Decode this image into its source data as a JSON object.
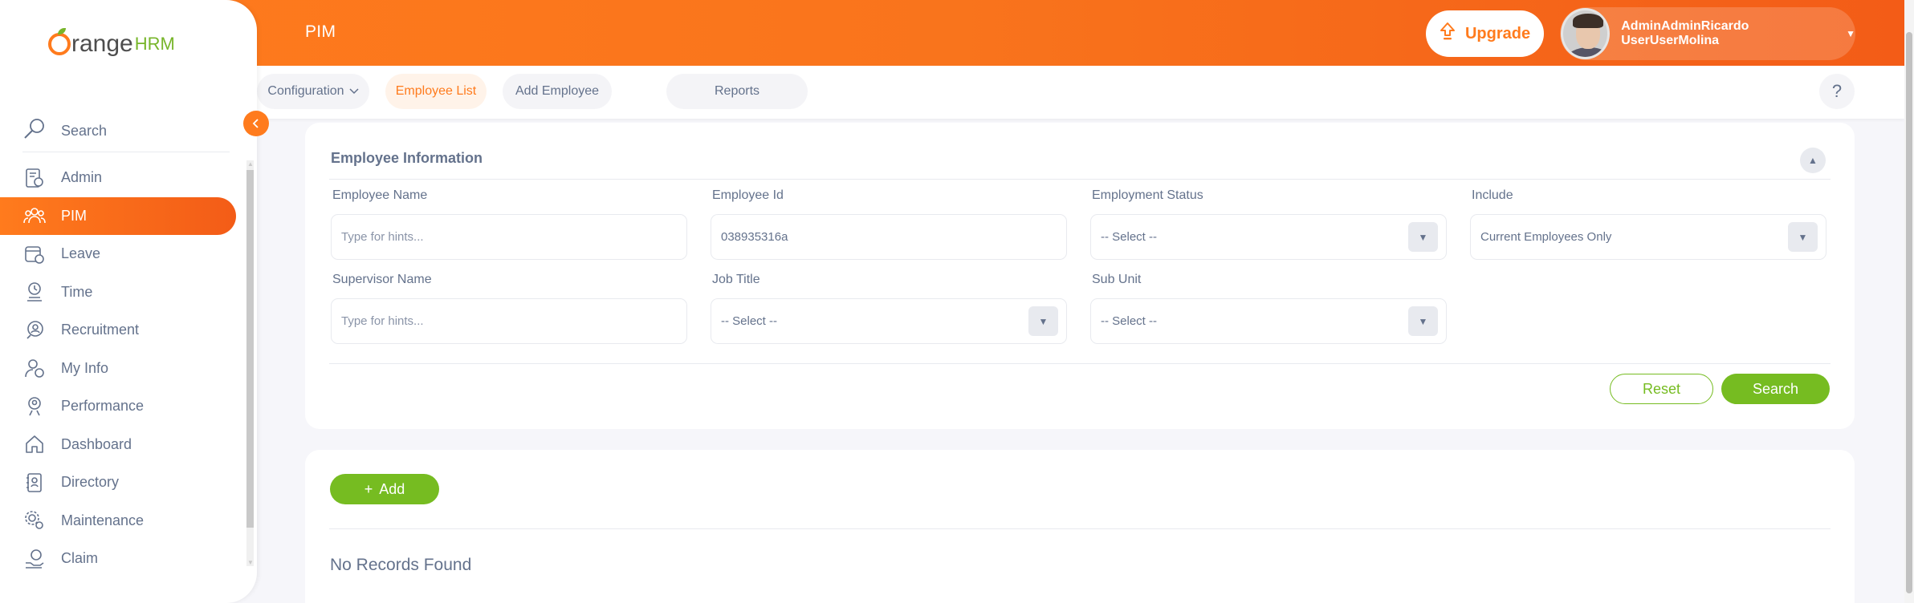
{
  "header": {
    "title": "PIM",
    "upgrade_label": "Upgrade",
    "user_name": "AdminAdminRicardo UserUserMolina"
  },
  "subnav": {
    "configuration": "Configuration",
    "employee_list": "Employee List",
    "add_employee": "Add Employee",
    "reports": "Reports",
    "help": "?"
  },
  "sidebar": {
    "logo_text": "range",
    "logo_suffix": "HRM",
    "search_label": "Search",
    "items": [
      {
        "label": "Admin"
      },
      {
        "label": "PIM"
      },
      {
        "label": "Leave"
      },
      {
        "label": "Time"
      },
      {
        "label": "Recruitment"
      },
      {
        "label": "My Info"
      },
      {
        "label": "Performance"
      },
      {
        "label": "Dashboard"
      },
      {
        "label": "Directory"
      },
      {
        "label": "Maintenance"
      },
      {
        "label": "Claim"
      }
    ]
  },
  "filter": {
    "heading": "Employee Information",
    "employee_name": {
      "label": "Employee Name",
      "placeholder": "Type for hints..."
    },
    "employee_id": {
      "label": "Employee Id",
      "value": "038935316a"
    },
    "employment_status": {
      "label": "Employment Status",
      "value": "-- Select --"
    },
    "include": {
      "label": "Include",
      "value": "Current Employees Only"
    },
    "supervisor_name": {
      "label": "Supervisor Name",
      "placeholder": "Type for hints..."
    },
    "job_title": {
      "label": "Job Title",
      "value": "-- Select --"
    },
    "sub_unit": {
      "label": "Sub Unit",
      "value": "-- Select --"
    },
    "reset_label": "Reset",
    "search_label": "Search"
  },
  "results": {
    "add_label": "Add",
    "empty_message": "No Records Found"
  },
  "colors": {
    "accent": "#ff7b1d",
    "green": "#76bc21",
    "text": "#64728c"
  }
}
